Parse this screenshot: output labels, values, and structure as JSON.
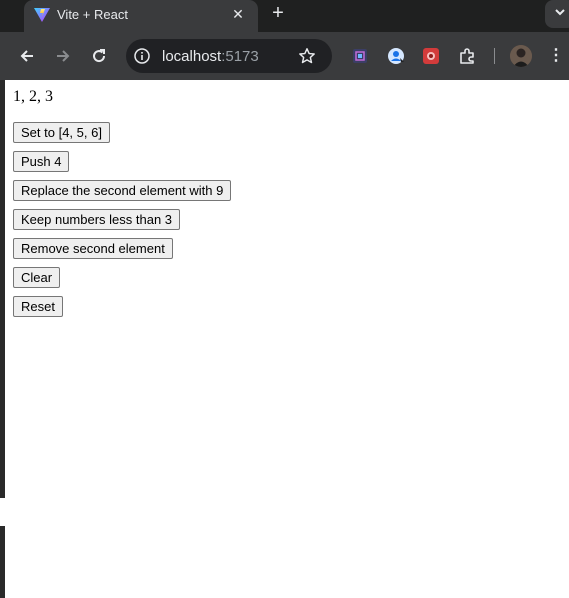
{
  "tab": {
    "title": "Vite + React",
    "favicon": "vite-icon",
    "close_icon": "close-icon"
  },
  "new_tab_icon": "plus-icon",
  "tab_search_icon": "chevron-down-icon",
  "toolbar": {
    "back_icon": "back-arrow-icon",
    "forward_icon": "forward-arrow-icon",
    "reload_icon": "reload-icon",
    "address": {
      "host": "localhost",
      "port": ":5173",
      "info_icon": "info-icon",
      "bookmark_icon": "star-icon"
    },
    "extensions": [
      "extension-puzzle-icon",
      "extension-user-icon",
      "extension-red-icon",
      "extensions-icon"
    ],
    "profile_icon": "avatar",
    "menu_icon": "kebab-menu-icon"
  },
  "page": {
    "array_display": "1, 2, 3",
    "buttons": [
      "Set to [4, 5, 6]",
      "Push 4",
      "Replace the second element with 9",
      "Keep numbers less than 3",
      "Remove second element",
      "Clear",
      "Reset"
    ]
  },
  "colors": {
    "chrome_dark": "#1f2020",
    "chrome_tab": "#3a3b3d",
    "omnibox_bg": "#202124",
    "button_bg": "#efefef",
    "button_border": "#767676"
  }
}
